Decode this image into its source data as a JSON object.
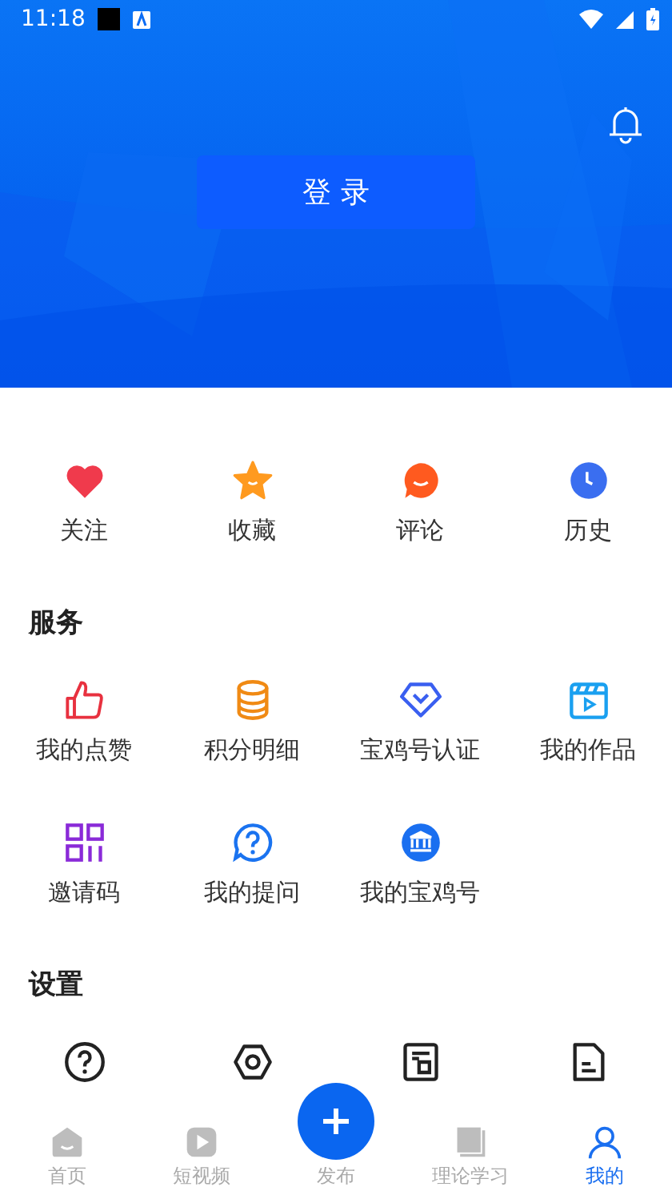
{
  "status_bar": {
    "time": "11:18"
  },
  "header": {
    "login_button": "登 录"
  },
  "quick_links": [
    {
      "label": "关注",
      "kind": "heart"
    },
    {
      "label": "收藏",
      "kind": "star"
    },
    {
      "label": "评论",
      "kind": "comment"
    },
    {
      "label": "历史",
      "kind": "clock"
    }
  ],
  "sections": [
    {
      "title": "服务",
      "items": [
        {
          "label": "我的点赞",
          "kind": "thumb"
        },
        {
          "label": "积分明细",
          "kind": "coins"
        },
        {
          "label": "宝鸡号认证",
          "kind": "diamond"
        },
        {
          "label": "我的作品",
          "kind": "clapper"
        },
        {
          "label": "邀请码",
          "kind": "grid"
        },
        {
          "label": "我的提问",
          "kind": "question-bubble"
        },
        {
          "label": "我的宝鸡号",
          "kind": "bank"
        }
      ]
    },
    {
      "title": "设置",
      "items": [
        {
          "kind": "help"
        },
        {
          "kind": "hexagon"
        },
        {
          "kind": "document-frame"
        },
        {
          "kind": "document"
        }
      ]
    }
  ],
  "bottom_nav": [
    {
      "label": "首页",
      "kind": "home",
      "selected": false
    },
    {
      "label": "短视频",
      "kind": "video",
      "selected": false
    },
    {
      "label": "发布",
      "kind": "publish",
      "selected": false
    },
    {
      "label": "理论学习",
      "kind": "book",
      "selected": false
    },
    {
      "label": "我的",
      "kind": "person",
      "selected": true
    }
  ]
}
